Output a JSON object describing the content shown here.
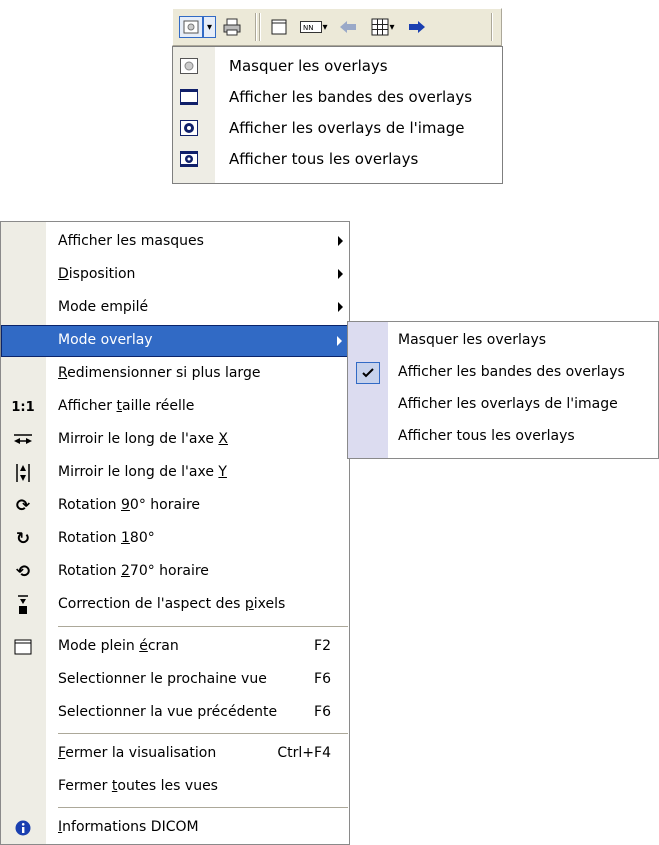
{
  "toolbar": {
    "buttons": [
      "overlay-toggle",
      "print",
      "fullscreen",
      "layout",
      "back",
      "grid",
      "forward"
    ]
  },
  "overlay_dropdown": {
    "items": [
      {
        "label": "Masquer les overlays",
        "icon": "overlay-hidden-icon"
      },
      {
        "label": "Afficher les bandes des overlays",
        "icon": "overlay-bands-icon"
      },
      {
        "label": "Afficher les overlays de l'image",
        "icon": "overlay-image-icon"
      },
      {
        "label": "Afficher tous les overlays",
        "icon": "overlay-all-icon"
      }
    ]
  },
  "context_menu": {
    "items": [
      {
        "label": "Afficher les masques",
        "submenu": true
      },
      {
        "label_pre": "",
        "label_ul": "D",
        "label_post": "isposition",
        "submenu": true
      },
      {
        "label": "Mode empilé",
        "submenu": true
      },
      {
        "label": "Mode overlay",
        "submenu": true,
        "highlighted": true
      },
      {
        "label_pre": "",
        "label_ul": "R",
        "label_post": "edimensionner si plus large"
      },
      {
        "label_pre": "Afficher ",
        "label_ul": "t",
        "label_post": "aille réelle",
        "icon_text": "1:1"
      },
      {
        "label_pre": "Mirroir le long de l'axe ",
        "label_ul": "X",
        "label_post": ""
      },
      {
        "label_pre": "Mirroir le long de l'axe ",
        "label_ul": "Y",
        "label_post": ""
      },
      {
        "label_pre": "Rotation ",
        "label_ul": "9",
        "label_post": "0° horaire"
      },
      {
        "label_pre": "Rotation ",
        "label_ul": "1",
        "label_post": "80°"
      },
      {
        "label_pre": "Rotation ",
        "label_ul": "2",
        "label_post": "70° horaire"
      },
      {
        "label_pre": "Correction de l'aspect des ",
        "label_ul": "p",
        "label_post": "ixels"
      },
      {
        "label_pre": "Mode plein ",
        "label_ul": "é",
        "label_post": "cran",
        "shortcut": "F2"
      },
      {
        "label": "Selectionner le prochaine vue",
        "shortcut": "F6"
      },
      {
        "label": "Selectionner la vue précédente",
        "shortcut": "F6"
      },
      {
        "label_pre": "",
        "label_ul": "F",
        "label_post": "ermer la visualisation",
        "shortcut": "Ctrl+F4"
      },
      {
        "label_pre": "Fermer ",
        "label_ul": "t",
        "label_post": "outes les vues"
      },
      {
        "label_pre": "",
        "label_ul": "I",
        "label_post": "nformations DICOM"
      }
    ]
  },
  "submenu": {
    "items": [
      {
        "label": "Masquer les overlays",
        "checked": false
      },
      {
        "label": "Afficher les bandes des overlays",
        "checked": true
      },
      {
        "label": "Afficher les overlays de l'image",
        "checked": false
      },
      {
        "label": "Afficher tous les overlays",
        "checked": false
      }
    ]
  },
  "colors": {
    "highlight": "#316ac5",
    "gutter": "#eeede5",
    "toolbar": "#ece9d8",
    "arrow_blue": "#1a3fb0"
  }
}
